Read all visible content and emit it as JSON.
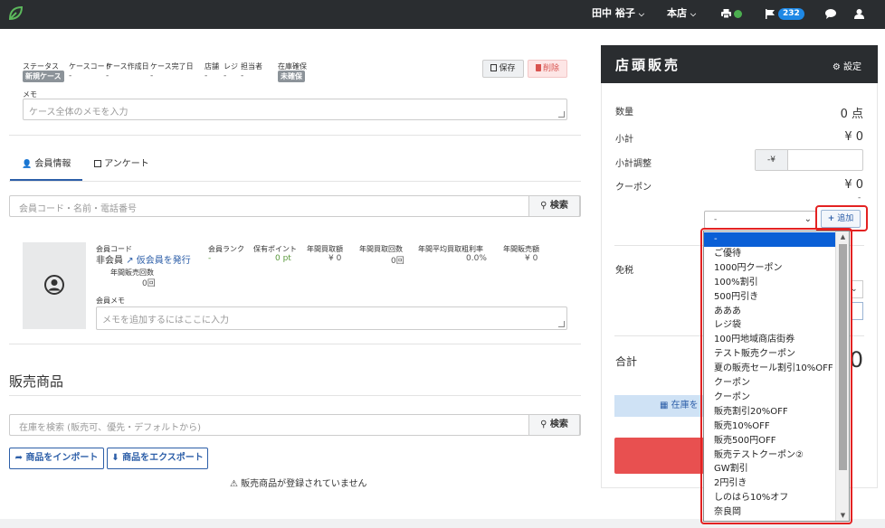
{
  "navbar": {
    "user": "田中 裕子",
    "store": "本店",
    "notification_count": "232"
  },
  "case": {
    "fields": [
      {
        "label": "ステータス",
        "value": "新規ケース"
      },
      {
        "label": "ケースコード",
        "value": "-"
      },
      {
        "label": "ケース作成日",
        "value": "-"
      },
      {
        "label": "ケース完了日",
        "value": "-"
      },
      {
        "label": "店舗",
        "value": "-"
      },
      {
        "label": "レジ",
        "value": "-"
      },
      {
        "label": "担当者",
        "value": "-"
      },
      {
        "label": "在庫確保",
        "value": "未確保"
      }
    ],
    "save_label": "保存",
    "delete_label": "削除",
    "memo_label": "メモ",
    "memo_placeholder": "ケース全体のメモを入力"
  },
  "tabs": [
    {
      "label": "会員情報"
    },
    {
      "label": "アンケート"
    }
  ],
  "member_search": {
    "placeholder": "会員コード・名前・電話番号",
    "button": "検索"
  },
  "member": {
    "code_label": "会員コード",
    "code_value": "非会員",
    "issue_link": "仮会員を発行",
    "stats": [
      {
        "label": "会員ランク",
        "value": "-"
      },
      {
        "label": "保有ポイント",
        "value": "0 pt"
      },
      {
        "label": "年間買取額",
        "value": "¥ 0"
      },
      {
        "label": "年間買取回数",
        "value": "0回"
      },
      {
        "label": "年間平均買取粗利率",
        "value": "0.0%"
      },
      {
        "label": "年間販売額",
        "value": "¥ 0"
      }
    ],
    "sales_count_label": "年間販売回数",
    "sales_count_value": "0回",
    "memo_label": "会員メモ",
    "memo_placeholder": "メモを追加するにはここに入力"
  },
  "products": {
    "title": "販売商品",
    "search_placeholder": "在庫を検索 (販売可、優先・デフォルトから)",
    "search_button": "検索",
    "import_label": "商品をインポート",
    "export_label": "商品をエクスポート",
    "empty_message": "販売商品が登録されていません"
  },
  "register": {
    "title": "店頭販売",
    "settings_label": "設定",
    "quantity_label": "数量",
    "quantity_value": "0 点",
    "subtotal_label": "小計",
    "subtotal_value": "¥ 0",
    "adjust_label": "小計調整",
    "adjust_prefix": "-¥",
    "coupon_label": "クーポン",
    "coupon_value": "¥ 0",
    "coupon_minor": "-",
    "coupon_select_value": "-",
    "add_label": "追加",
    "tax_label": "免税",
    "total_label": "合計",
    "total_value": "0",
    "stock_button": "在庫を"
  },
  "coupon_options": [
    "-",
    "ご優待",
    "1000円クーポン",
    "100%割引",
    "500円引き",
    "あああ",
    "レジ袋",
    "100円地域商店街券",
    "テスト販売クーポン",
    "夏の販売セール割引10%OFF",
    "クーポン",
    "クーポン",
    "販売割引20%OFF",
    "販売10%OFF",
    "販売500円OFF",
    "販売テストクーポン②",
    "GW割引",
    "2円引き",
    "しのはら10%オフ",
    "奈良岡"
  ],
  "colors": {
    "navbar": "#2a2d30",
    "accent": "#2c5ea8",
    "highlight_outline": "#e32222",
    "selected_option": "#0a5fd6"
  }
}
